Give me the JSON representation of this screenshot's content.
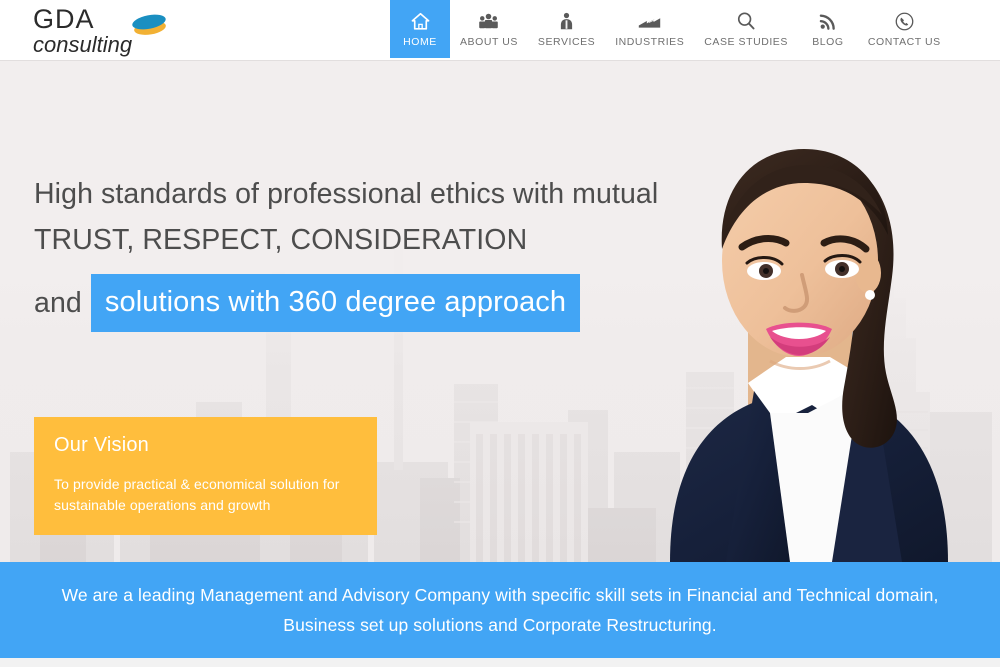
{
  "site": {
    "logo_primary": "GDA",
    "logo_secondary": "consulting",
    "logo_mark_blue": "#1a8fc1",
    "logo_mark_yellow": "#f2b134"
  },
  "nav": {
    "active_index": 0,
    "items": [
      {
        "label": "HOME",
        "icon": "home-icon"
      },
      {
        "label": "ABOUT US",
        "icon": "people-group-icon"
      },
      {
        "label": "SERVICES",
        "icon": "person-support-icon"
      },
      {
        "label": "INDUSTRIES",
        "icon": "factory-icon"
      },
      {
        "label": "CASE STUDIES",
        "icon": "magnifier-icon"
      },
      {
        "label": "BLOG",
        "icon": "rss-icon"
      },
      {
        "label": "CONTACT US",
        "icon": "phone-circle-icon"
      }
    ]
  },
  "hero": {
    "headline_line1": "High standards of professional ethics with mutual",
    "headline_line2": "TRUST, RESPECT, CONSIDERATION",
    "headline_line3_prefix": "and",
    "headline_highlight": "solutions with 360 degree approach",
    "vision_title": "Our Vision",
    "vision_body": "To provide practical & economical solution for sustainable operations and growth",
    "background": "grayscale-city-skyline",
    "photo": "smiling-businesswoman-in-navy-blazer"
  },
  "banner": {
    "text": "We are a leading Management and Advisory Company with specific skill sets in Financial and Technical domain, Business set up solutions and Corporate Restructuring."
  },
  "colors": {
    "accent_blue": "#42a5f5",
    "accent_yellow": "#ffbe3d",
    "hero_bg": "#f0ecec",
    "text_dark": "#4d4d4d",
    "nav_text": "#6f6f6f"
  }
}
